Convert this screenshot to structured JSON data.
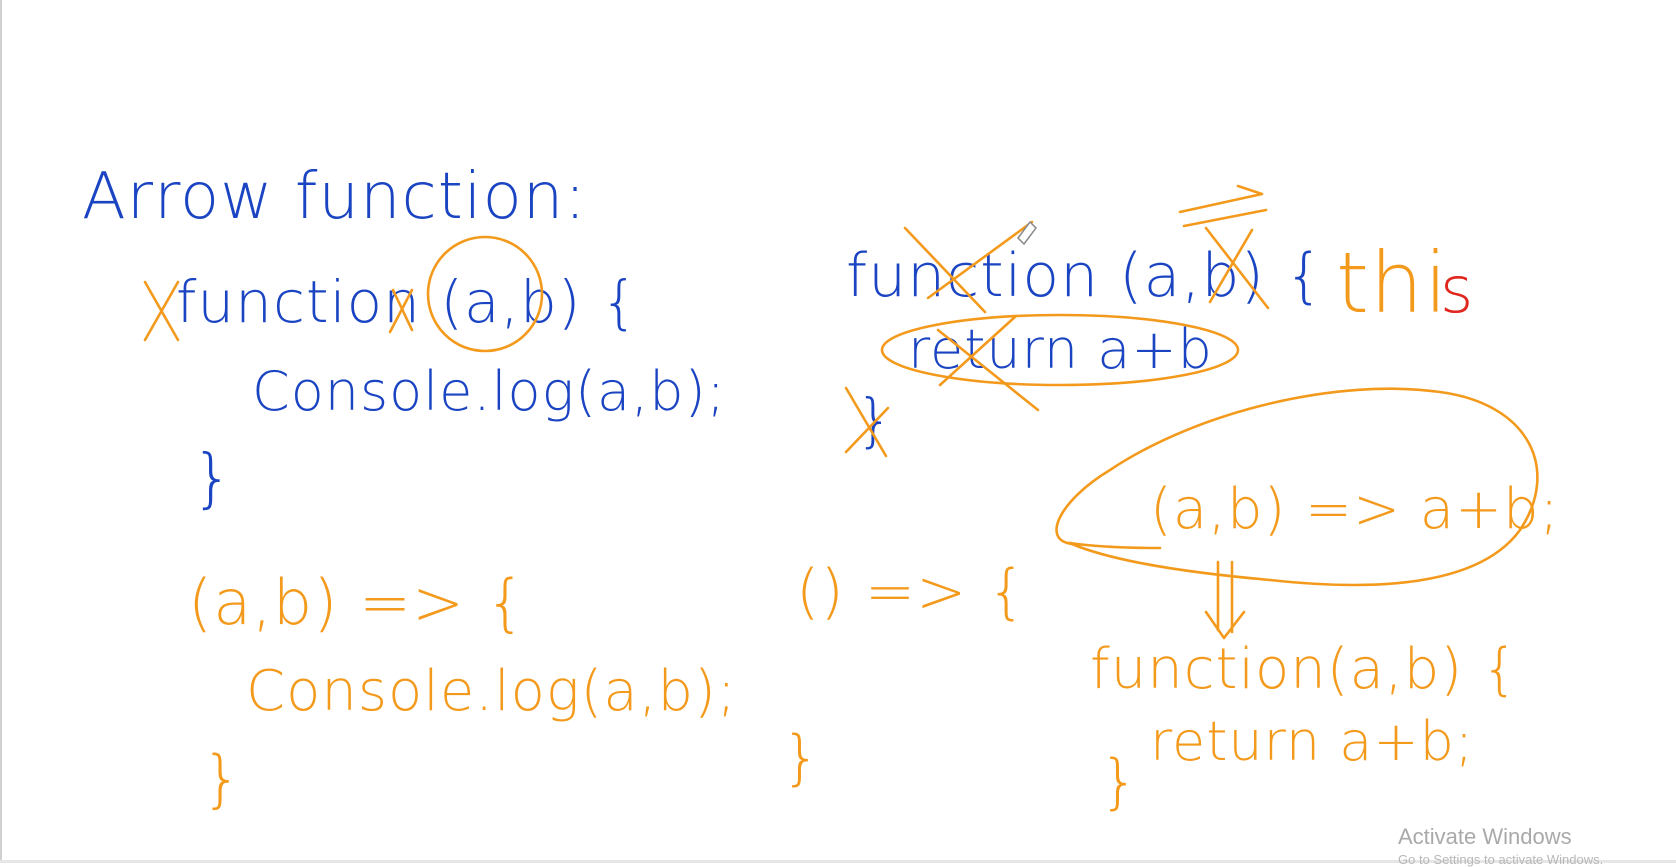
{
  "whiteboard": {
    "heading": "Arrow function:",
    "regular_function": {
      "header": "function (a,b) {",
      "body": "Console.log(a,b);",
      "close": "}"
    },
    "arrow_function": {
      "header": "(a,b) => {",
      "body": "Console.log(a,b);",
      "close": "}"
    },
    "crossed_function": {
      "header": "function (a,b) {",
      "body": "return a+b",
      "close": "}"
    },
    "empty_arrow": {
      "header": "() => {",
      "close": "}"
    },
    "keyword_this": {
      "part1": "thi",
      "part2": "s"
    },
    "concise_arrow": "(a,b) => a+b;",
    "expanded_function": {
      "header": "function(a,b) {",
      "body": "return a+b;",
      "close": "}"
    }
  },
  "watermark": {
    "line1": "Activate Windows",
    "line2": "Go to Settings to activate Windows."
  },
  "colors": {
    "pen_blue": "#1a44c2",
    "pen_orange": "#f39a1c",
    "pen_red": "#e0261e"
  }
}
